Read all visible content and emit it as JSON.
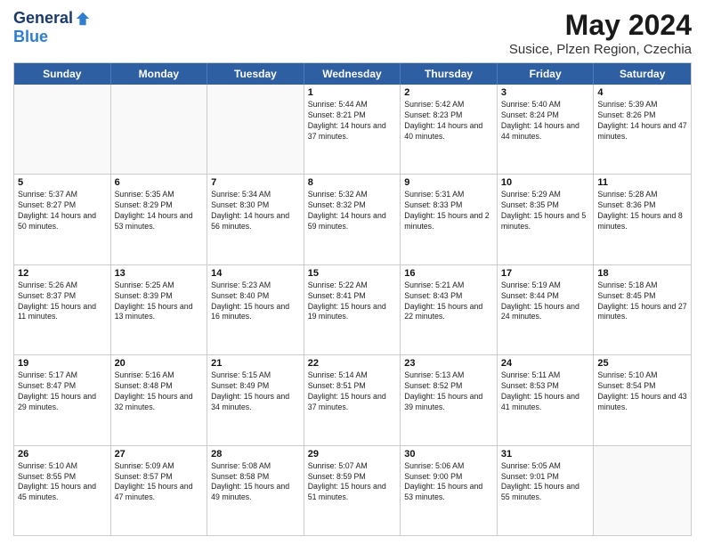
{
  "header": {
    "logo_general": "General",
    "logo_blue": "Blue",
    "month_year": "May 2024",
    "location": "Susice, Plzen Region, Czechia"
  },
  "days_of_week": [
    "Sunday",
    "Monday",
    "Tuesday",
    "Wednesday",
    "Thursday",
    "Friday",
    "Saturday"
  ],
  "weeks": [
    [
      {
        "day": "",
        "sunrise": "",
        "sunset": "",
        "daylight": ""
      },
      {
        "day": "",
        "sunrise": "",
        "sunset": "",
        "daylight": ""
      },
      {
        "day": "",
        "sunrise": "",
        "sunset": "",
        "daylight": ""
      },
      {
        "day": "1",
        "sunrise": "Sunrise: 5:44 AM",
        "sunset": "Sunset: 8:21 PM",
        "daylight": "Daylight: 14 hours and 37 minutes."
      },
      {
        "day": "2",
        "sunrise": "Sunrise: 5:42 AM",
        "sunset": "Sunset: 8:23 PM",
        "daylight": "Daylight: 14 hours and 40 minutes."
      },
      {
        "day": "3",
        "sunrise": "Sunrise: 5:40 AM",
        "sunset": "Sunset: 8:24 PM",
        "daylight": "Daylight: 14 hours and 44 minutes."
      },
      {
        "day": "4",
        "sunrise": "Sunrise: 5:39 AM",
        "sunset": "Sunset: 8:26 PM",
        "daylight": "Daylight: 14 hours and 47 minutes."
      }
    ],
    [
      {
        "day": "5",
        "sunrise": "Sunrise: 5:37 AM",
        "sunset": "Sunset: 8:27 PM",
        "daylight": "Daylight: 14 hours and 50 minutes."
      },
      {
        "day": "6",
        "sunrise": "Sunrise: 5:35 AM",
        "sunset": "Sunset: 8:29 PM",
        "daylight": "Daylight: 14 hours and 53 minutes."
      },
      {
        "day": "7",
        "sunrise": "Sunrise: 5:34 AM",
        "sunset": "Sunset: 8:30 PM",
        "daylight": "Daylight: 14 hours and 56 minutes."
      },
      {
        "day": "8",
        "sunrise": "Sunrise: 5:32 AM",
        "sunset": "Sunset: 8:32 PM",
        "daylight": "Daylight: 14 hours and 59 minutes."
      },
      {
        "day": "9",
        "sunrise": "Sunrise: 5:31 AM",
        "sunset": "Sunset: 8:33 PM",
        "daylight": "Daylight: 15 hours and 2 minutes."
      },
      {
        "day": "10",
        "sunrise": "Sunrise: 5:29 AM",
        "sunset": "Sunset: 8:35 PM",
        "daylight": "Daylight: 15 hours and 5 minutes."
      },
      {
        "day": "11",
        "sunrise": "Sunrise: 5:28 AM",
        "sunset": "Sunset: 8:36 PM",
        "daylight": "Daylight: 15 hours and 8 minutes."
      }
    ],
    [
      {
        "day": "12",
        "sunrise": "Sunrise: 5:26 AM",
        "sunset": "Sunset: 8:37 PM",
        "daylight": "Daylight: 15 hours and 11 minutes."
      },
      {
        "day": "13",
        "sunrise": "Sunrise: 5:25 AM",
        "sunset": "Sunset: 8:39 PM",
        "daylight": "Daylight: 15 hours and 13 minutes."
      },
      {
        "day": "14",
        "sunrise": "Sunrise: 5:23 AM",
        "sunset": "Sunset: 8:40 PM",
        "daylight": "Daylight: 15 hours and 16 minutes."
      },
      {
        "day": "15",
        "sunrise": "Sunrise: 5:22 AM",
        "sunset": "Sunset: 8:41 PM",
        "daylight": "Daylight: 15 hours and 19 minutes."
      },
      {
        "day": "16",
        "sunrise": "Sunrise: 5:21 AM",
        "sunset": "Sunset: 8:43 PM",
        "daylight": "Daylight: 15 hours and 22 minutes."
      },
      {
        "day": "17",
        "sunrise": "Sunrise: 5:19 AM",
        "sunset": "Sunset: 8:44 PM",
        "daylight": "Daylight: 15 hours and 24 minutes."
      },
      {
        "day": "18",
        "sunrise": "Sunrise: 5:18 AM",
        "sunset": "Sunset: 8:45 PM",
        "daylight": "Daylight: 15 hours and 27 minutes."
      }
    ],
    [
      {
        "day": "19",
        "sunrise": "Sunrise: 5:17 AM",
        "sunset": "Sunset: 8:47 PM",
        "daylight": "Daylight: 15 hours and 29 minutes."
      },
      {
        "day": "20",
        "sunrise": "Sunrise: 5:16 AM",
        "sunset": "Sunset: 8:48 PM",
        "daylight": "Daylight: 15 hours and 32 minutes."
      },
      {
        "day": "21",
        "sunrise": "Sunrise: 5:15 AM",
        "sunset": "Sunset: 8:49 PM",
        "daylight": "Daylight: 15 hours and 34 minutes."
      },
      {
        "day": "22",
        "sunrise": "Sunrise: 5:14 AM",
        "sunset": "Sunset: 8:51 PM",
        "daylight": "Daylight: 15 hours and 37 minutes."
      },
      {
        "day": "23",
        "sunrise": "Sunrise: 5:13 AM",
        "sunset": "Sunset: 8:52 PM",
        "daylight": "Daylight: 15 hours and 39 minutes."
      },
      {
        "day": "24",
        "sunrise": "Sunrise: 5:11 AM",
        "sunset": "Sunset: 8:53 PM",
        "daylight": "Daylight: 15 hours and 41 minutes."
      },
      {
        "day": "25",
        "sunrise": "Sunrise: 5:10 AM",
        "sunset": "Sunset: 8:54 PM",
        "daylight": "Daylight: 15 hours and 43 minutes."
      }
    ],
    [
      {
        "day": "26",
        "sunrise": "Sunrise: 5:10 AM",
        "sunset": "Sunset: 8:55 PM",
        "daylight": "Daylight: 15 hours and 45 minutes."
      },
      {
        "day": "27",
        "sunrise": "Sunrise: 5:09 AM",
        "sunset": "Sunset: 8:57 PM",
        "daylight": "Daylight: 15 hours and 47 minutes."
      },
      {
        "day": "28",
        "sunrise": "Sunrise: 5:08 AM",
        "sunset": "Sunset: 8:58 PM",
        "daylight": "Daylight: 15 hours and 49 minutes."
      },
      {
        "day": "29",
        "sunrise": "Sunrise: 5:07 AM",
        "sunset": "Sunset: 8:59 PM",
        "daylight": "Daylight: 15 hours and 51 minutes."
      },
      {
        "day": "30",
        "sunrise": "Sunrise: 5:06 AM",
        "sunset": "Sunset: 9:00 PM",
        "daylight": "Daylight: 15 hours and 53 minutes."
      },
      {
        "day": "31",
        "sunrise": "Sunrise: 5:05 AM",
        "sunset": "Sunset: 9:01 PM",
        "daylight": "Daylight: 15 hours and 55 minutes."
      },
      {
        "day": "",
        "sunrise": "",
        "sunset": "",
        "daylight": ""
      }
    ]
  ]
}
